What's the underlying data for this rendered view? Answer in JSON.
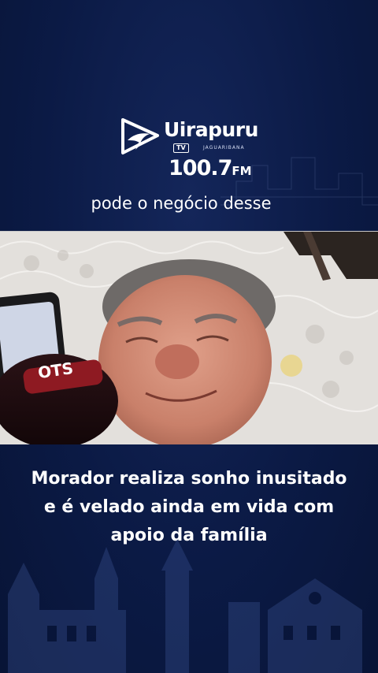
{
  "brand": {
    "name": "Uirapuru",
    "tv": "TV",
    "subtitle": "JAGUARIBANA",
    "frequency": "100.7",
    "frequency_unit": "FM"
  },
  "caption_top": "pode o negócio desse",
  "headline": {
    "line1": "Morador realiza sonho inusitado",
    "line2": "e é velado ainda em vida com",
    "line3": "apoio da família"
  },
  "microphone": {
    "label": "OTS"
  },
  "colors": {
    "background": "#0b1a45",
    "text": "#ffffff",
    "mic_accent": "#d0202a"
  }
}
